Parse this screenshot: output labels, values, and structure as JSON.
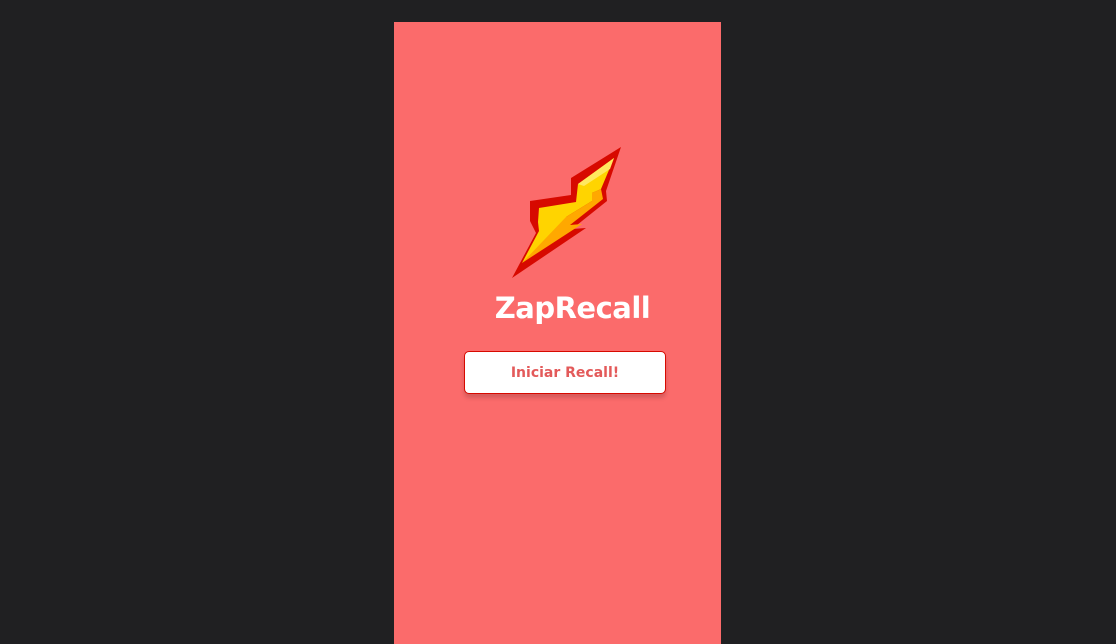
{
  "app": {
    "title": "ZapRecall"
  },
  "start": {
    "button_label": "Iniciar Recall!"
  },
  "icons": {
    "logo": "lightning-bolt-icon"
  },
  "colors": {
    "page_background": "#202022",
    "screen_background": "#FB6B6B",
    "button_background": "#FFFFFF",
    "button_border": "#D70900",
    "button_text": "#E35A5A",
    "title_text": "#FFFFFF",
    "bolt_outline": "#D70900",
    "bolt_fill": "#FFD400",
    "bolt_shade": "#FFA800"
  }
}
